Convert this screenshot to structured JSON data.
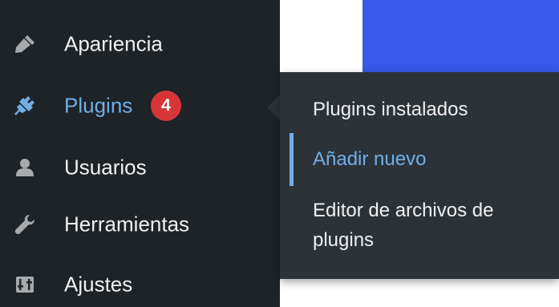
{
  "sidebar": {
    "items": [
      {
        "label": "Apariencia",
        "icon": "paintbrush-icon"
      },
      {
        "label": "Plugins",
        "icon": "plug-icon",
        "badge": "4"
      },
      {
        "label": "Usuarios",
        "icon": "user-icon"
      },
      {
        "label": "Herramientas",
        "icon": "wrench-icon"
      },
      {
        "label": "Ajustes",
        "icon": "sliders-icon"
      }
    ]
  },
  "flyout": {
    "items": [
      {
        "label": "Plugins instalados"
      },
      {
        "label": "Añadir nuevo"
      },
      {
        "label": "Editor de archivos de plugins"
      }
    ]
  },
  "colors": {
    "sidebar_bg": "#1d2327",
    "flyout_bg": "#2c3338",
    "accent": "#72aee6",
    "badge": "#d63638",
    "banner": "#3858e9"
  }
}
